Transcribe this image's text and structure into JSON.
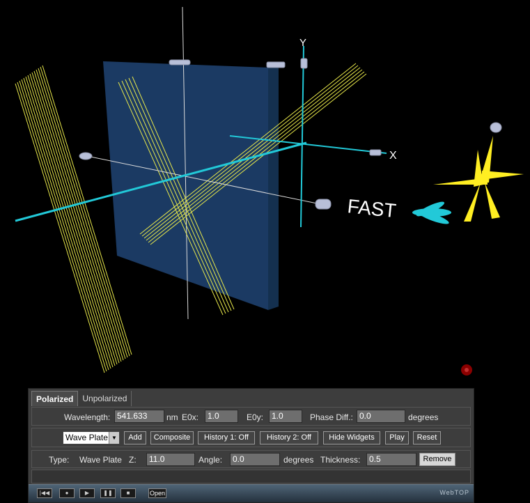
{
  "scene": {
    "fast_label": "FAST",
    "x_axis_label": "X",
    "y_axis_label": "Y"
  },
  "tabs": [
    {
      "label": "Polarized",
      "active": true
    },
    {
      "label": "Unpolarized",
      "active": false
    }
  ],
  "wave_row": {
    "wavelength_label": "Wavelength:",
    "wavelength_value": "541.633",
    "wavelength_unit": "nm",
    "e0x_label": "E0x:",
    "e0x_value": "1.0",
    "e0y_label": "E0y:",
    "e0y_value": "1.0",
    "phase_label": "Phase Diff.:",
    "phase_value": "0.0",
    "phase_unit": "degrees"
  },
  "element_row": {
    "element_select": "Wave Plate",
    "add": "Add",
    "composite": "Composite",
    "history1": "History 1: Off",
    "history2": "History 2: Off",
    "hide_widgets": "Hide Widgets",
    "play": "Play",
    "reset": "Reset"
  },
  "props_row": {
    "type_label": "Type:",
    "type_value": "Wave Plate",
    "z_label": "Z:",
    "z_value": "11.0",
    "angle_label": "Angle:",
    "angle_value": "0.0",
    "angle_unit": "degrees",
    "thickness_label": "Thickness:",
    "thickness_value": "0.5",
    "remove": "Remove"
  },
  "player": {
    "open": "Open",
    "brand": "WebTOP"
  },
  "colors": {
    "background": "#000000",
    "plate": "#1b3a63",
    "beam": "#22c9d8",
    "polarization": "#e8e84a",
    "fast_marker": "#ffee22",
    "record_dot": "#8b0000"
  }
}
